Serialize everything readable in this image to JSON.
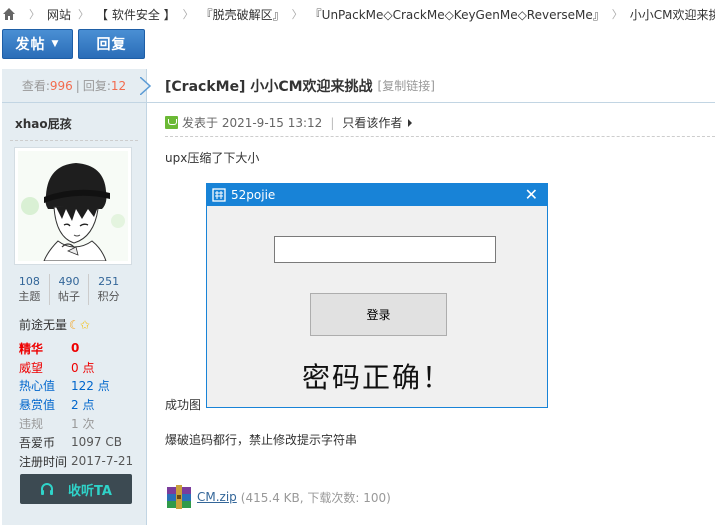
{
  "breadcrumb": {
    "items": [
      "网站",
      "【 软件安全 】",
      "『脱壳破解区』",
      "『UnPackMe◇CrackMe◇KeyGenMe◇ReverseMe』",
      "小小CM欢迎来挑战"
    ]
  },
  "actions": {
    "post_label": "发帖",
    "reply_label": "回复"
  },
  "stats": {
    "views_label": "查看:",
    "views": "996",
    "replies_label": "回复:",
    "replies": "12"
  },
  "author": {
    "name": "xhao屁孩",
    "counts": [
      {
        "value": "108",
        "label": "主题"
      },
      {
        "value": "490",
        "label": "帖子"
      },
      {
        "value": "251",
        "label": "积分"
      }
    ],
    "rank": "前途无量",
    "attributes": [
      {
        "key": "精华",
        "value": "0"
      },
      {
        "key": "威望",
        "value": "0 点"
      },
      {
        "key": "热心值",
        "value": "122 点"
      },
      {
        "key": "悬赏值",
        "value": "2 点"
      },
      {
        "key": "违规",
        "value": "1 次"
      },
      {
        "key": "吾爱币",
        "value": "1097 CB"
      },
      {
        "key": "注册时间",
        "value": "2017-7-21"
      }
    ],
    "listen_label": "收听TA"
  },
  "post": {
    "title": "[CrackMe] 小小CM欢迎来挑战",
    "copy_link": "[复制链接]",
    "posted_at": "发表于 2021-9-15 13:12",
    "only_author": "只看该作者",
    "line1": "upx压缩了下大小",
    "line2": "成功图",
    "line3": "爆破追码都行，禁止修改提示字符串"
  },
  "dialog": {
    "title": "52pojie",
    "close": "✕",
    "login_label": "登录",
    "result": "密码正确！"
  },
  "attachment": {
    "name": "CM.zip",
    "meta": "(415.4 KB, 下载次数: 100)"
  },
  "colors": {
    "accent_blue": "#2a6db8",
    "dialog_title": "#1883d7",
    "stat_number": "#f26c4f",
    "sidebar_bg": "#e5edf2"
  }
}
